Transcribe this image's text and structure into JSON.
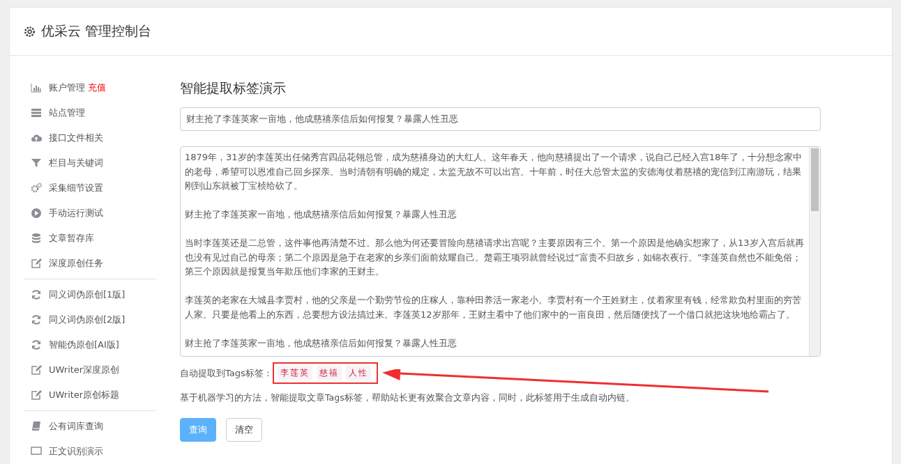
{
  "header": {
    "title": "优采云 管理控制台"
  },
  "sidebar": {
    "groups": [
      {
        "items": [
          {
            "label": "账户管理",
            "badge": "充值",
            "kind": "chart"
          },
          {
            "label": "站点管理",
            "kind": "server"
          },
          {
            "label": "接口文件相关",
            "kind": "cloud"
          },
          {
            "label": "栏目与关键词",
            "kind": "filter"
          },
          {
            "label": "采集细节设置",
            "kind": "gears"
          },
          {
            "label": "手动运行测试",
            "kind": "play"
          },
          {
            "label": "文章暂存库",
            "kind": "database"
          },
          {
            "label": "深度原创任务",
            "kind": "edit"
          }
        ]
      },
      {
        "items": [
          {
            "label": "同义词伪原创[1版]",
            "kind": "refresh"
          },
          {
            "label": "同义词伪原创[2版]",
            "kind": "refresh"
          },
          {
            "label": "智能伪原创[AI版]",
            "kind": "refresh"
          },
          {
            "label": "UWriter深度原创",
            "kind": "edit"
          },
          {
            "label": "UWriter原创标题",
            "kind": "edit"
          }
        ]
      },
      {
        "items": [
          {
            "label": "公有词库查询",
            "kind": "book"
          },
          {
            "label": "正文识别演示",
            "kind": "monitor"
          }
        ]
      }
    ]
  },
  "main": {
    "heading": "智能提取标签演示",
    "title_field": {
      "value": "财主抢了李莲英家一亩地，他成慈禧亲信后如何报复？暴露人性丑恶"
    },
    "content_paragraphs": [
      "1879年，31岁的李莲英出任储秀宫四品花翎总管，成为慈禧身边的大红人。这年春天，他向慈禧提出了一个请求，说自己已经入宫18年了，十分想念家中的老母，希望可以恩准自己回乡探亲。当时清朝有明确的规定，太监无故不可以出宫。十年前，时任大总管太监的安德海仗着慈禧的宠信到江南游玩，结果刚到山东就被丁宝桢给砍了。",
      "财主抢了李莲英家一亩地，他成慈禧亲信后如何报复？暴露人性丑恶",
      "当时李莲英还是二总管，这件事他再清楚不过。那么他为何还要冒险向慈禧请求出宫呢？主要原因有三个。第一个原因是他确实想家了，从13岁入宫后就再也没有见过自己的母亲；第二个原因是急于在老家的乡亲们面前炫耀自己。楚霸王项羽就曾经说过“富贵不归故乡，如锦衣夜行。”李莲英自然也不能免俗；第三个原因就是报复当年欺压他们李家的王财主。",
      "李莲英的老家在大城县李贾村，他的父亲是一个勤劳节俭的庄稼人，靠种田养活一家老小。李贾村有一个王姓财主，仗着家里有钱，经常欺负村里面的穷苦人家。只要是他看上的东西，总要想方设法搞过来。李莲英12岁那年，王财主看中了他们家中的一亩良田，然后随便找了一个借口就把这块地给霸占了。",
      "财主抢了李莲英家一亩地，他成慈禧亲信后如何报复？暴露人性丑恶"
    ],
    "tags_label": "自动提取到Tags标签：",
    "tags": [
      "李莲英",
      "慈禧",
      "人性"
    ],
    "description": "基于机器学习的方法，智能提取文章Tags标签，帮助站长更有效聚合文章内容，同时，此标签用于生成自动内链。",
    "buttons": [
      {
        "label": "查询",
        "kind": "primary"
      },
      {
        "label": "清空",
        "kind": "default"
      }
    ]
  }
}
